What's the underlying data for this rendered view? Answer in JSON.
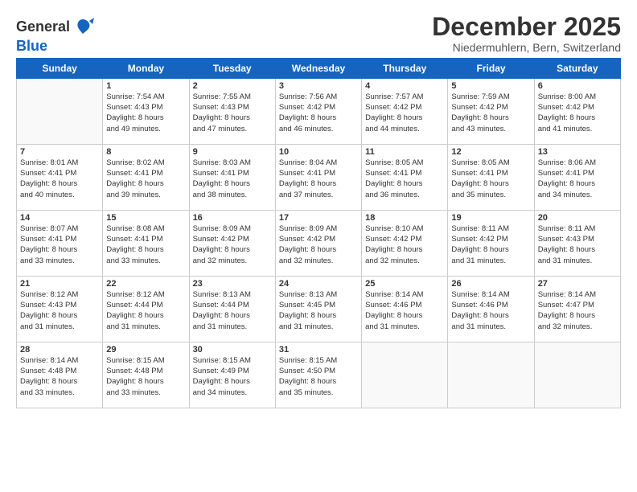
{
  "header": {
    "logo_line1": "General",
    "logo_line2": "Blue",
    "month_title": "December 2025",
    "subtitle": "Niedermuhlern, Bern, Switzerland"
  },
  "weekdays": [
    "Sunday",
    "Monday",
    "Tuesday",
    "Wednesday",
    "Thursday",
    "Friday",
    "Saturday"
  ],
  "weeks": [
    [
      {
        "day": "",
        "info": ""
      },
      {
        "day": "1",
        "info": "Sunrise: 7:54 AM\nSunset: 4:43 PM\nDaylight: 8 hours\nand 49 minutes."
      },
      {
        "day": "2",
        "info": "Sunrise: 7:55 AM\nSunset: 4:43 PM\nDaylight: 8 hours\nand 47 minutes."
      },
      {
        "day": "3",
        "info": "Sunrise: 7:56 AM\nSunset: 4:42 PM\nDaylight: 8 hours\nand 46 minutes."
      },
      {
        "day": "4",
        "info": "Sunrise: 7:57 AM\nSunset: 4:42 PM\nDaylight: 8 hours\nand 44 minutes."
      },
      {
        "day": "5",
        "info": "Sunrise: 7:59 AM\nSunset: 4:42 PM\nDaylight: 8 hours\nand 43 minutes."
      },
      {
        "day": "6",
        "info": "Sunrise: 8:00 AM\nSunset: 4:42 PM\nDaylight: 8 hours\nand 41 minutes."
      }
    ],
    [
      {
        "day": "7",
        "info": "Sunrise: 8:01 AM\nSunset: 4:41 PM\nDaylight: 8 hours\nand 40 minutes."
      },
      {
        "day": "8",
        "info": "Sunrise: 8:02 AM\nSunset: 4:41 PM\nDaylight: 8 hours\nand 39 minutes."
      },
      {
        "day": "9",
        "info": "Sunrise: 8:03 AM\nSunset: 4:41 PM\nDaylight: 8 hours\nand 38 minutes."
      },
      {
        "day": "10",
        "info": "Sunrise: 8:04 AM\nSunset: 4:41 PM\nDaylight: 8 hours\nand 37 minutes."
      },
      {
        "day": "11",
        "info": "Sunrise: 8:05 AM\nSunset: 4:41 PM\nDaylight: 8 hours\nand 36 minutes."
      },
      {
        "day": "12",
        "info": "Sunrise: 8:05 AM\nSunset: 4:41 PM\nDaylight: 8 hours\nand 35 minutes."
      },
      {
        "day": "13",
        "info": "Sunrise: 8:06 AM\nSunset: 4:41 PM\nDaylight: 8 hours\nand 34 minutes."
      }
    ],
    [
      {
        "day": "14",
        "info": "Sunrise: 8:07 AM\nSunset: 4:41 PM\nDaylight: 8 hours\nand 33 minutes."
      },
      {
        "day": "15",
        "info": "Sunrise: 8:08 AM\nSunset: 4:41 PM\nDaylight: 8 hours\nand 33 minutes."
      },
      {
        "day": "16",
        "info": "Sunrise: 8:09 AM\nSunset: 4:42 PM\nDaylight: 8 hours\nand 32 minutes."
      },
      {
        "day": "17",
        "info": "Sunrise: 8:09 AM\nSunset: 4:42 PM\nDaylight: 8 hours\nand 32 minutes."
      },
      {
        "day": "18",
        "info": "Sunrise: 8:10 AM\nSunset: 4:42 PM\nDaylight: 8 hours\nand 32 minutes."
      },
      {
        "day": "19",
        "info": "Sunrise: 8:11 AM\nSunset: 4:42 PM\nDaylight: 8 hours\nand 31 minutes."
      },
      {
        "day": "20",
        "info": "Sunrise: 8:11 AM\nSunset: 4:43 PM\nDaylight: 8 hours\nand 31 minutes."
      }
    ],
    [
      {
        "day": "21",
        "info": "Sunrise: 8:12 AM\nSunset: 4:43 PM\nDaylight: 8 hours\nand 31 minutes."
      },
      {
        "day": "22",
        "info": "Sunrise: 8:12 AM\nSunset: 4:44 PM\nDaylight: 8 hours\nand 31 minutes."
      },
      {
        "day": "23",
        "info": "Sunrise: 8:13 AM\nSunset: 4:44 PM\nDaylight: 8 hours\nand 31 minutes."
      },
      {
        "day": "24",
        "info": "Sunrise: 8:13 AM\nSunset: 4:45 PM\nDaylight: 8 hours\nand 31 minutes."
      },
      {
        "day": "25",
        "info": "Sunrise: 8:14 AM\nSunset: 4:46 PM\nDaylight: 8 hours\nand 31 minutes."
      },
      {
        "day": "26",
        "info": "Sunrise: 8:14 AM\nSunset: 4:46 PM\nDaylight: 8 hours\nand 31 minutes."
      },
      {
        "day": "27",
        "info": "Sunrise: 8:14 AM\nSunset: 4:47 PM\nDaylight: 8 hours\nand 32 minutes."
      }
    ],
    [
      {
        "day": "28",
        "info": "Sunrise: 8:14 AM\nSunset: 4:48 PM\nDaylight: 8 hours\nand 33 minutes."
      },
      {
        "day": "29",
        "info": "Sunrise: 8:15 AM\nSunset: 4:48 PM\nDaylight: 8 hours\nand 33 minutes."
      },
      {
        "day": "30",
        "info": "Sunrise: 8:15 AM\nSunset: 4:49 PM\nDaylight: 8 hours\nand 34 minutes."
      },
      {
        "day": "31",
        "info": "Sunrise: 8:15 AM\nSunset: 4:50 PM\nDaylight: 8 hours\nand 35 minutes."
      },
      {
        "day": "",
        "info": ""
      },
      {
        "day": "",
        "info": ""
      },
      {
        "day": "",
        "info": ""
      }
    ]
  ]
}
